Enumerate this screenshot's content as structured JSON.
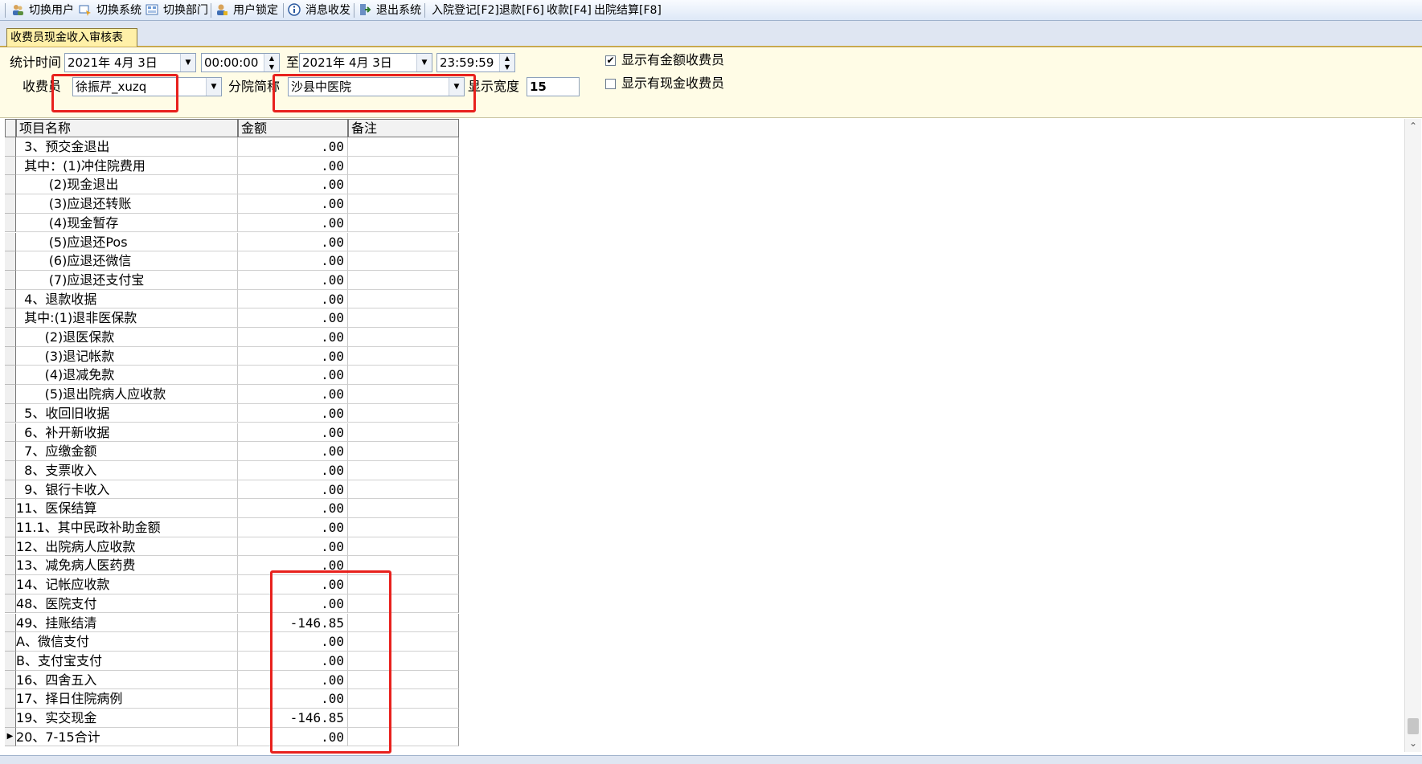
{
  "toolbar": {
    "items": [
      {
        "label": "切换用户",
        "icon": "users-icon"
      },
      {
        "label": "切换系统",
        "icon": "switch-system-icon"
      },
      {
        "label": "切换部门",
        "icon": "department-icon"
      },
      {
        "label": "用户锁定",
        "icon": "user-lock-icon"
      },
      {
        "label": "消息收发",
        "icon": "info-icon"
      },
      {
        "label": "退出系统",
        "icon": "exit-icon"
      },
      {
        "label": "入院登记[F2]"
      },
      {
        "label": "退款[F6]"
      },
      {
        "label": "收款[F4]"
      },
      {
        "label": "出院结算[F8]"
      }
    ]
  },
  "tab": {
    "label": "收费员现金收入审核表"
  },
  "filters": {
    "stat_time_label": "统计时间",
    "start_date": "2021年 4月 3日",
    "start_time": "00:00:00",
    "to_label": "至",
    "end_date": "2021年 4月 3日",
    "end_time": "23:59:59",
    "cashier_label": "收费员",
    "cashier_value": "徐振芹_xuzq",
    "branch_label": "分院简称",
    "branch_value": "沙县中医院",
    "width_label": "显示宽度",
    "width_value": "15",
    "check1_label": "显示有金额收费员",
    "check1_checked": true,
    "check2_label": "显示有现金收费员",
    "check2_checked": false,
    "check_mark": "✔"
  },
  "grid": {
    "headers": [
      "项目名称",
      "金额",
      "备注"
    ],
    "rows": [
      {
        "name": "  3、预交金退出",
        "amount": ".00"
      },
      {
        "name": "  其中：(1)冲住院费用",
        "amount": ".00"
      },
      {
        "name": "        (2)现金退出",
        "amount": ".00"
      },
      {
        "name": "        (3)应退还转账",
        "amount": ".00"
      },
      {
        "name": "        (4)现金暂存",
        "amount": ".00"
      },
      {
        "name": "        (5)应退还Pos",
        "amount": ".00"
      },
      {
        "name": "        (6)应退还微信",
        "amount": ".00"
      },
      {
        "name": "        (7)应退还支付宝",
        "amount": ".00"
      },
      {
        "name": "  4、退款收据",
        "amount": ".00"
      },
      {
        "name": "  其中:(1)退非医保款",
        "amount": ".00"
      },
      {
        "name": "       (2)退医保款",
        "amount": ".00"
      },
      {
        "name": "       (3)退记帐款",
        "amount": ".00"
      },
      {
        "name": "       (4)退减免款",
        "amount": ".00"
      },
      {
        "name": "       (5)退出院病人应收款",
        "amount": ".00"
      },
      {
        "name": "  5、收回旧收据",
        "amount": ".00"
      },
      {
        "name": "  6、补开新收据",
        "amount": ".00"
      },
      {
        "name": "  7、应缴金额",
        "amount": ".00"
      },
      {
        "name": "  8、支票收入",
        "amount": ".00"
      },
      {
        "name": "  9、银行卡收入",
        "amount": ".00"
      },
      {
        "name": "11、医保结算",
        "amount": ".00"
      },
      {
        "name": "11.1、其中民政补助金额",
        "amount": ".00"
      },
      {
        "name": "12、出院病人应收款",
        "amount": ".00"
      },
      {
        "name": "13、减免病人医药费",
        "amount": ".00"
      },
      {
        "name": "14、记帐应收款",
        "amount": ".00"
      },
      {
        "name": "48、医院支付",
        "amount": ".00"
      },
      {
        "name": "49、挂账结清",
        "amount": "-146.85"
      },
      {
        "name": "A、微信支付",
        "amount": ".00"
      },
      {
        "name": "B、支付宝支付",
        "amount": ".00"
      },
      {
        "name": "16、四舍五入",
        "amount": ".00"
      },
      {
        "name": "17、择日住院病例",
        "amount": ".00"
      },
      {
        "name": "19、实交现金",
        "amount": "-146.85"
      },
      {
        "name": "20、7-15合计",
        "amount": ".00"
      }
    ],
    "current_row_marker": "▶"
  }
}
